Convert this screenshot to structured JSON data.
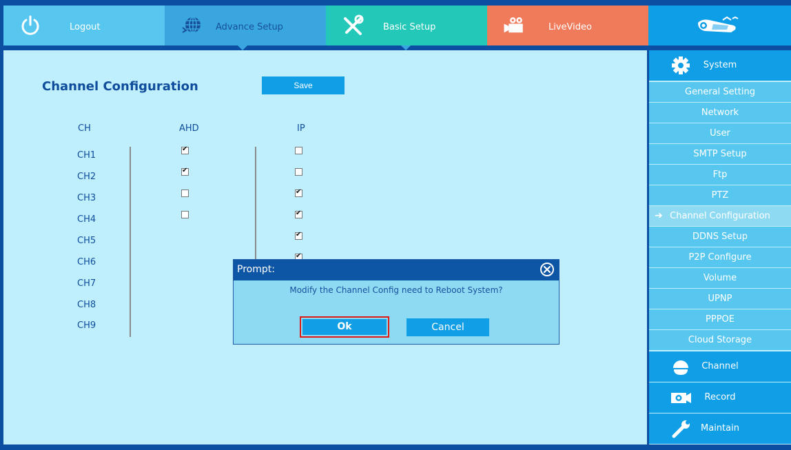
{
  "topbar": {
    "tabs": [
      {
        "label": "Logout",
        "icon": "power-icon"
      },
      {
        "label": "Advance Setup",
        "icon": "globe-icon"
      },
      {
        "label": "Basic Setup",
        "icon": "tools-icon"
      },
      {
        "label": "LiveVideo",
        "icon": "video-camera-icon"
      },
      {
        "label": "",
        "icon": "cctv-camera-logo-icon"
      }
    ]
  },
  "main": {
    "title": "Channel Configuration",
    "save_label": "Save",
    "columns": {
      "ch": "CH",
      "ahd": "AHD",
      "ip": "IP"
    },
    "channels": [
      {
        "name": "CH1",
        "ahd": true,
        "ip": false
      },
      {
        "name": "CH2",
        "ahd": true,
        "ip": false
      },
      {
        "name": "CH3",
        "ahd": false,
        "ip": true
      },
      {
        "name": "CH4",
        "ahd": false,
        "ip": true
      },
      {
        "name": "CH5",
        "ip": true
      },
      {
        "name": "CH6",
        "ip": true
      },
      {
        "name": "CH7"
      },
      {
        "name": "CH8"
      },
      {
        "name": "CH9"
      }
    ]
  },
  "sidebar": {
    "system_label": "System",
    "items": [
      {
        "label": "General Setting"
      },
      {
        "label": "Network"
      },
      {
        "label": "User"
      },
      {
        "label": "SMTP Setup"
      },
      {
        "label": "Ftp"
      },
      {
        "label": "PTZ"
      },
      {
        "label": "Channel Configuration",
        "active": true
      },
      {
        "label": "DDNS Setup"
      },
      {
        "label": "P2P Configure"
      },
      {
        "label": "Volume"
      },
      {
        "label": "UPNP"
      },
      {
        "label": "PPPOE"
      },
      {
        "label": "Cloud Storage"
      }
    ],
    "channel_label": "Channel",
    "record_label": "Record",
    "maintain_label": "Maintain"
  },
  "dialog": {
    "title": "Prompt:",
    "message": "Modify the Channel Config need to Reboot System?",
    "ok_label": "Ok",
    "cancel_label": "Cancel"
  },
  "colors": {
    "logout_tab": "#58c7ef",
    "advance_tab": "#3aa6e0",
    "basic_tab": "#23c8b9",
    "live_tab": "#ef7b5a",
    "accent": "#109ee6",
    "highlight_border": "#e01818"
  }
}
